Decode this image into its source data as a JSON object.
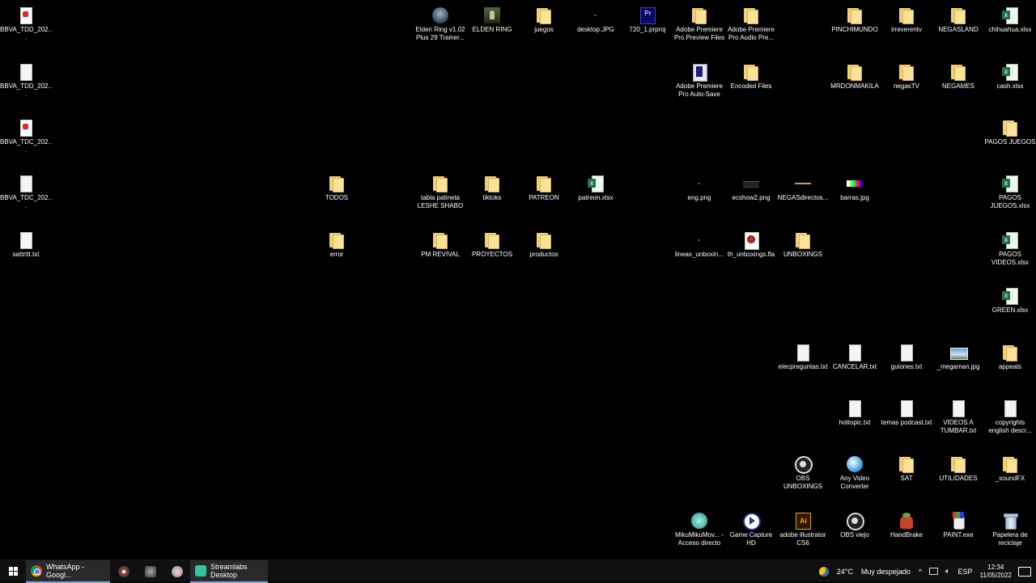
{
  "desktop": {
    "icons": [
      {
        "label": "BBVA_TDD_202...",
        "type": "pdf"
      },
      {
        "label": "BBVA_TDD_202...",
        "type": "doc"
      },
      {
        "label": "BBVA_TDC_202...",
        "type": "pdf"
      },
      {
        "label": "BBVA_TDC_202...",
        "type": "doc"
      },
      {
        "label": "sattrttt.txt",
        "type": "doc"
      },
      {
        "label": "TODOS",
        "type": "folder"
      },
      {
        "label": "error",
        "type": "folder"
      },
      {
        "label": "Elden Ring v1.02 Plus 29 Trainer...",
        "type": "game"
      },
      {
        "label": "ELDEN RING",
        "type": "gamesq"
      },
      {
        "label": "juegos",
        "type": "folder"
      },
      {
        "label": "desktop.JPG",
        "type": "blank"
      },
      {
        "label": "720_1.prproj",
        "type": "prproj"
      },
      {
        "label": "Adobe Premiere Pro Preview Files",
        "type": "folder"
      },
      {
        "label": "Adobe Premiere Pro Audio Pre...",
        "type": "folder"
      },
      {
        "label": "Adobe Premiere Pro Auto-Save",
        "type": "prfolder"
      },
      {
        "label": "Encoded Files",
        "type": "folder"
      },
      {
        "label": "tabla patineta LESHE SHABO",
        "type": "folder"
      },
      {
        "label": "tiktoks",
        "type": "folder"
      },
      {
        "label": "PATREON",
        "type": "folder"
      },
      {
        "label": "patreon.xlsx",
        "type": "xlsx"
      },
      {
        "label": "PM REVIVAL",
        "type": "folder"
      },
      {
        "label": "PROYECTOS",
        "type": "folder"
      },
      {
        "label": "productos",
        "type": "folder"
      },
      {
        "label": "eng.png",
        "type": "blank"
      },
      {
        "label": "ecshow2.png",
        "type": "imgdark"
      },
      {
        "label": "NEGASdirectos...",
        "type": "imgline"
      },
      {
        "label": "barras.jpg",
        "type": "imgbars"
      },
      {
        "label": "lineas_unboxin...",
        "type": "blank"
      },
      {
        "label": "th_unboxings.fla",
        "type": "fla"
      },
      {
        "label": "UNBOXINGS",
        "type": "folder"
      },
      {
        "label": "PINCHIMUNDO",
        "type": "folder"
      },
      {
        "label": "irreverentv",
        "type": "folder"
      },
      {
        "label": "NEGASLAND",
        "type": "folder"
      },
      {
        "label": "chihuahua.xlsx",
        "type": "xlsx"
      },
      {
        "label": "MRDONMAKILA",
        "type": "folder"
      },
      {
        "label": "negasTV",
        "type": "folder"
      },
      {
        "label": "NEGAMES",
        "type": "folder"
      },
      {
        "label": "cash.xlsx",
        "type": "xlsx"
      },
      {
        "label": "PAGOS JUEGOS",
        "type": "folder"
      },
      {
        "label": "PAGOS JUEGOS.xlsx",
        "type": "xlsx"
      },
      {
        "label": "PAGOS VIDEOS.xlsx",
        "type": "xlsx"
      },
      {
        "label": "GREEN.xlsx",
        "type": "xlsx"
      },
      {
        "label": "elecpreguntas.txt",
        "type": "doc"
      },
      {
        "label": "CANCELAR.txt",
        "type": "doc"
      },
      {
        "label": "guiones.txt",
        "type": "doc"
      },
      {
        "label": "_megaman.jpg",
        "type": "img"
      },
      {
        "label": "appeals",
        "type": "folder"
      },
      {
        "label": "hottopic.txt",
        "type": "doc"
      },
      {
        "label": "temas podcast.txt",
        "type": "doc"
      },
      {
        "label": "VIDEOS A TUMBAR.txt",
        "type": "doc"
      },
      {
        "label": "copyrights english descr...",
        "type": "doc"
      },
      {
        "label": "OBS UNBOXINGS",
        "type": "obs"
      },
      {
        "label": "Any Video Converter",
        "type": "avc"
      },
      {
        "label": "SAT",
        "type": "folder"
      },
      {
        "label": "UTILIDADES",
        "type": "folder"
      },
      {
        "label": "_soundFX",
        "type": "folder"
      },
      {
        "label": "MikuMikuMov... - Acceso directo",
        "type": "mmd"
      },
      {
        "label": "Game Capture HD",
        "type": "gc"
      },
      {
        "label": "adobe illustrator CS6",
        "type": "ai"
      },
      {
        "label": "OBS viejo",
        "type": "obs"
      },
      {
        "label": "HandBrake",
        "type": "hb"
      },
      {
        "label": "PAINT.exe",
        "type": "paint"
      },
      {
        "label": "Papelera de reciclaje",
        "type": "bin"
      }
    ]
  },
  "taskbar": {
    "tasks": [
      {
        "label": "WhatsApp - Googl...",
        "icon": "chrome-icon"
      },
      {
        "label": "",
        "icon": "app-icon-1"
      },
      {
        "label": "",
        "icon": "app-icon-2"
      },
      {
        "label": "",
        "icon": "app-icon-3"
      },
      {
        "label": "Streamlabs Desktop",
        "icon": "streamlabs-icon"
      }
    ],
    "weather": {
      "temp": "24°C",
      "condition": "Muy despejado"
    },
    "language": "ESP",
    "time": "12:34",
    "date": "11/05/2022"
  }
}
